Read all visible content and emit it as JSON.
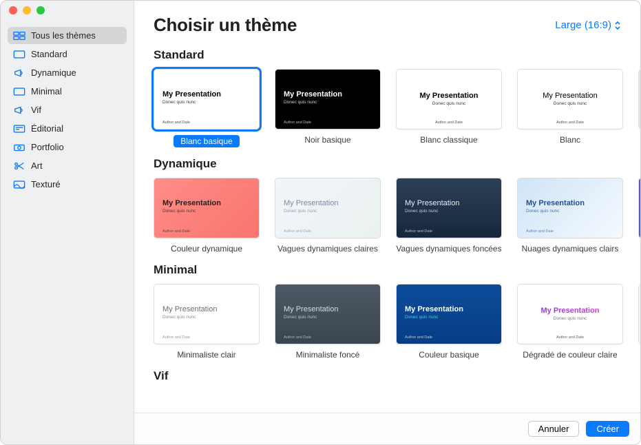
{
  "header": {
    "title": "Choisir un thème",
    "size_selector": "Large (16:9)"
  },
  "sidebar": {
    "items": [
      {
        "label": "Tous les thèmes"
      },
      {
        "label": "Standard"
      },
      {
        "label": "Dynamique"
      },
      {
        "label": "Minimal"
      },
      {
        "label": "Vif"
      },
      {
        "label": "Éditorial"
      },
      {
        "label": "Portfolio"
      },
      {
        "label": "Art"
      },
      {
        "label": "Texturé"
      }
    ]
  },
  "thumb_text": {
    "title": "My Presentation",
    "subtitle": "Donec quis nunc",
    "footer": "Author and Date"
  },
  "sections": {
    "standard": {
      "title": "Standard",
      "items": [
        {
          "label": "Blanc basique"
        },
        {
          "label": "Noir basique"
        },
        {
          "label": "Blanc classique"
        },
        {
          "label": "Blanc"
        }
      ]
    },
    "dynamique": {
      "title": "Dynamique",
      "items": [
        {
          "label": "Couleur dynamique"
        },
        {
          "label": "Vagues dynamiques claires"
        },
        {
          "label": "Vagues dynamiques foncées"
        },
        {
          "label": "Nuages dynamiques clairs"
        }
      ]
    },
    "minimal": {
      "title": "Minimal",
      "items": [
        {
          "label": "Minimaliste clair"
        },
        {
          "label": "Minimaliste foncé"
        },
        {
          "label": "Couleur basique"
        },
        {
          "label": "Dégradé de couleur claire"
        }
      ]
    },
    "vif": {
      "title": "Vif"
    }
  },
  "footer": {
    "cancel": "Annuler",
    "create": "Créer"
  }
}
